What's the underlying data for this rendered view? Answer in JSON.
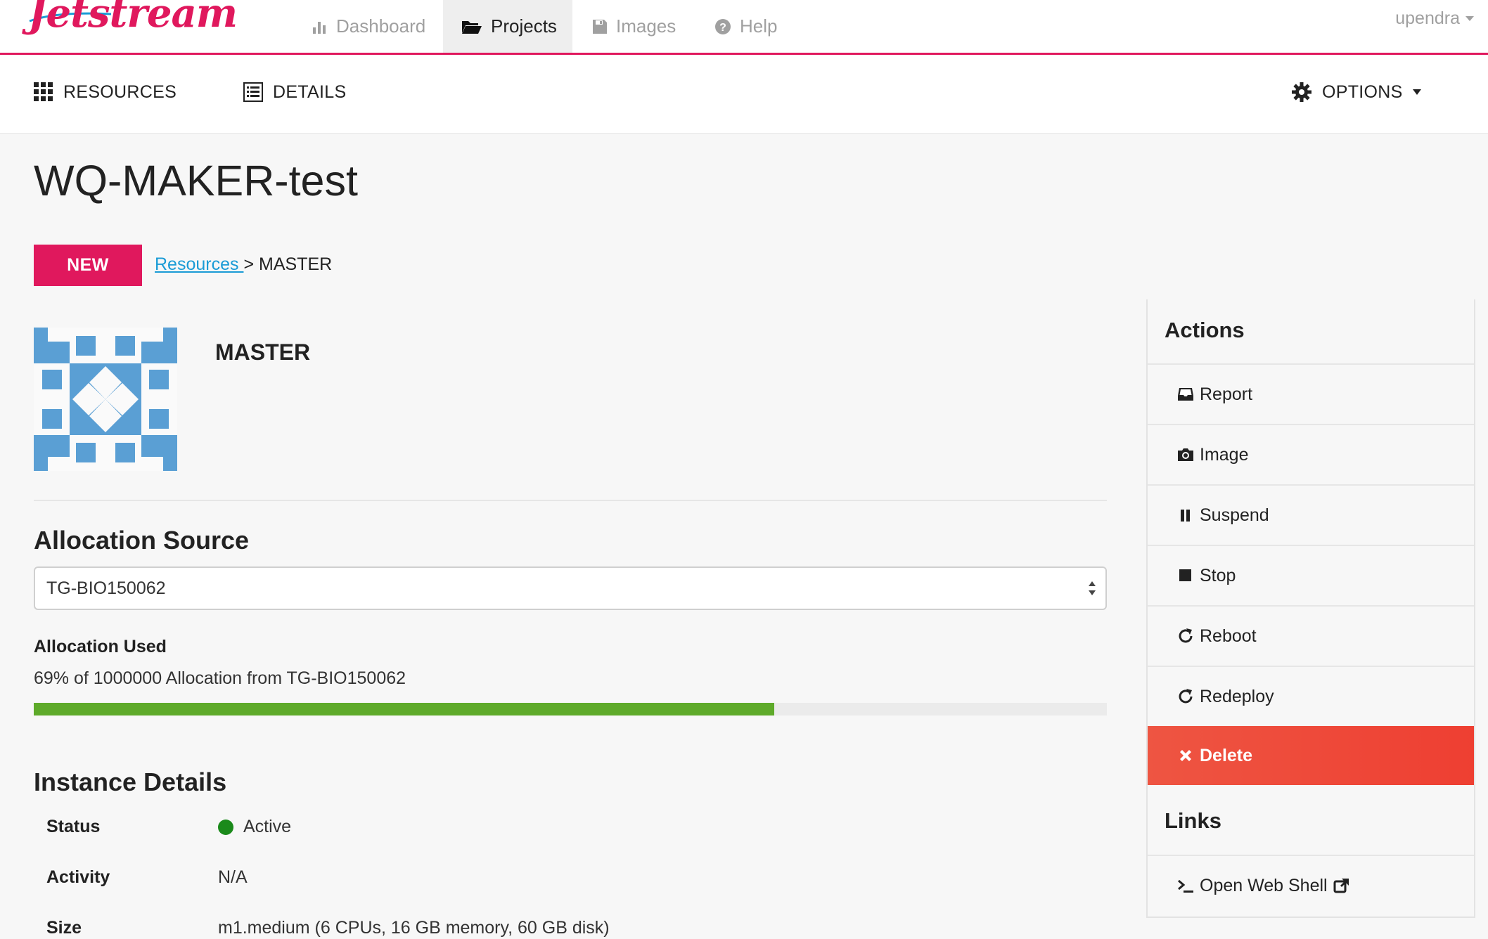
{
  "app": {
    "brand": "Jetstream",
    "accent": "#e0185d"
  },
  "topnav": {
    "items": [
      {
        "label": "Dashboard",
        "icon": "bar-chart-icon",
        "active": false
      },
      {
        "label": "Projects",
        "icon": "folder-open-icon",
        "active": true
      },
      {
        "label": "Images",
        "icon": "floppy-disk-icon",
        "active": false
      },
      {
        "label": "Help",
        "icon": "question-circle-icon",
        "active": false
      }
    ],
    "user": "upendra"
  },
  "subnav": {
    "resources": "RESOURCES",
    "details": "DETAILS",
    "options": "OPTIONS"
  },
  "page": {
    "title": "WQ-MAKER-test",
    "badge": "NEW",
    "breadcrumb_link": "Resources ",
    "breadcrumb_sep": ">",
    "breadcrumb_current": "MASTER"
  },
  "instance": {
    "name": "MASTER"
  },
  "allocation": {
    "section_title": "Allocation Source",
    "selected": "TG-BIO150062",
    "used_label": "Allocation Used",
    "used_text": "69% of 1000000 Allocation from TG-BIO150062",
    "used_percent": 69,
    "bar_color": "#5eaa2a"
  },
  "details": {
    "section_title": "Instance Details",
    "rows": [
      {
        "key": "Status",
        "value": "Active",
        "status_color": "#1b8a1b"
      },
      {
        "key": "Activity",
        "value": "N/A"
      },
      {
        "key": "Size",
        "value": "m1.medium (6 CPUs, 16 GB memory, 60 GB disk)"
      }
    ]
  },
  "sidebar": {
    "actions_title": "Actions",
    "actions": [
      {
        "label": "Report",
        "icon": "inbox-icon"
      },
      {
        "label": "Image",
        "icon": "camera-icon"
      },
      {
        "label": "Suspend",
        "icon": "pause-icon"
      },
      {
        "label": "Stop",
        "icon": "stop-icon"
      },
      {
        "label": "Reboot",
        "icon": "refresh-icon"
      },
      {
        "label": "Redeploy",
        "icon": "refresh-icon"
      },
      {
        "label": "Delete",
        "icon": "times-icon",
        "danger_color": "#ee4a3a"
      }
    ],
    "links_title": "Links",
    "links": [
      {
        "label": "Open Web Shell",
        "icon": "terminal-icon",
        "trailing_icon": "external-link-icon"
      }
    ]
  }
}
